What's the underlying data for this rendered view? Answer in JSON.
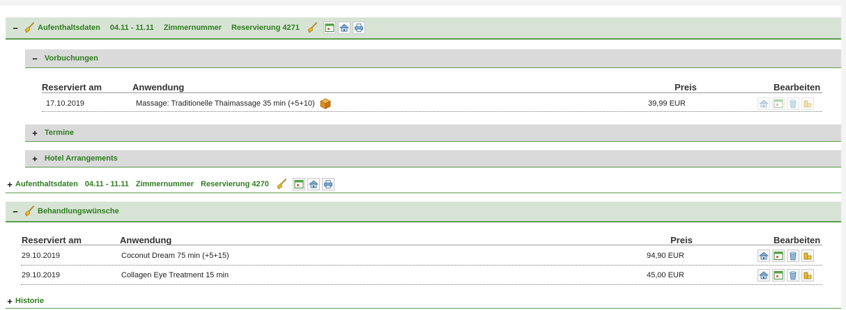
{
  "stay1": {
    "label": "Aufenthaltsdaten",
    "dates": "04.11 - 11.11",
    "room": "Zimmernummer",
    "reservation": "Reservierung 4271"
  },
  "prebookings": {
    "label": "Vorbuchungen",
    "columns": {
      "date": "Reserviert am",
      "app": "Anwendung",
      "price": "Preis",
      "edit": "Bearbeiten"
    },
    "rows": [
      {
        "date": "17.10.2019",
        "app": "Massage: Traditionelle Thaimassage 35 min (+5+10)",
        "price": "39,99 EUR"
      }
    ]
  },
  "appointments": {
    "label": "Termine"
  },
  "arrangements": {
    "label": "Hotel Arrangements"
  },
  "stay2": {
    "label": "Aufenthaltsdaten",
    "dates": "04.11 - 11.11",
    "room": "Zimmernummer",
    "reservation": "Reservierung 4270"
  },
  "wishes": {
    "label": "Behandlungswünsche",
    "columns": {
      "date": "Reserviert am",
      "app": "Anwendung",
      "price": "Preis",
      "edit": "Bearbeiten"
    },
    "rows": [
      {
        "date": "29.10.2019",
        "app": "Coconut Dream 75 min (+5+15)",
        "price": "94,90 EUR"
      },
      {
        "date": "29.10.2019",
        "app": "Collagen Eye Treatment 15 min",
        "price": "45,00 EUR"
      }
    ]
  },
  "history": {
    "label": "Historie"
  },
  "toggles": {
    "expanded": "−",
    "collapsed": "+"
  },
  "icons": [
    "broom-icon",
    "calendar-icon",
    "house-icon",
    "printer-icon",
    "trash-icon",
    "coins-icon",
    "package-icon"
  ]
}
